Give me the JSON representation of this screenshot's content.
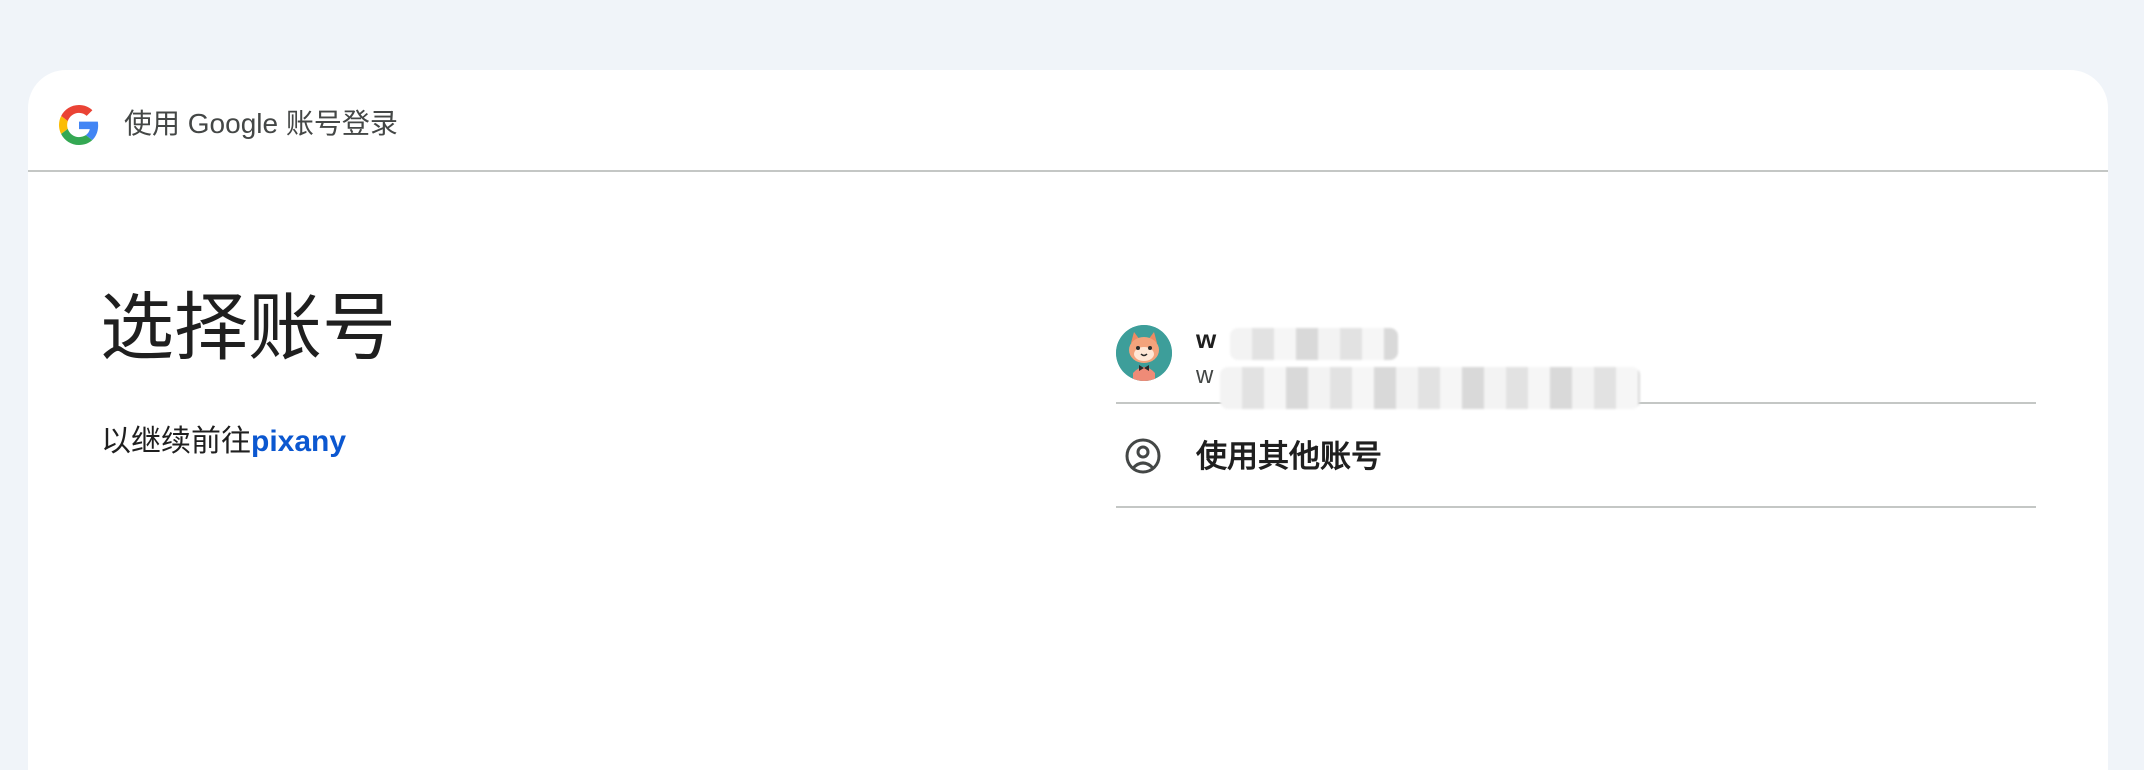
{
  "header": {
    "title": "使用 Google 账号登录",
    "logo_icon": "google-g-logo"
  },
  "main": {
    "title": "选择账号",
    "subtitle_prefix": "以继续前往",
    "app_name": "pixany"
  },
  "accounts": [
    {
      "name_visible": "w",
      "email_visible": "w",
      "avatar_icon": "cat-avatar",
      "avatar_color": "#3d9e9a"
    }
  ],
  "other_account": {
    "label": "使用其他账号",
    "icon": "account-circle-icon"
  },
  "colors": {
    "page_bg": "#f0f4f9",
    "card_bg": "#ffffff",
    "link": "#0b57d0",
    "divider": "#c4c7c5",
    "text": "#1f1f1f",
    "muted_text": "#444746"
  }
}
